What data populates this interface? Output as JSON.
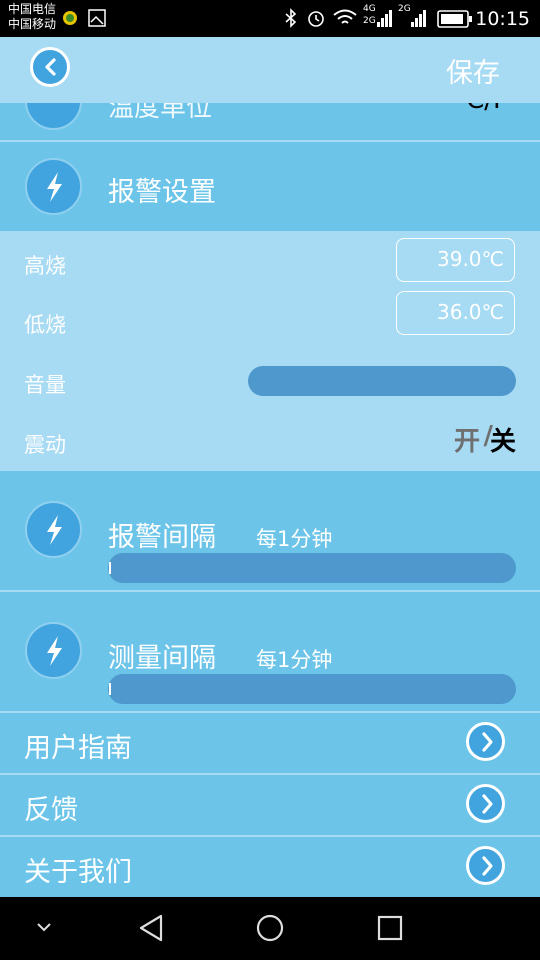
{
  "status_bar": {
    "carrier_1": "中国电信",
    "carrier_2": "中国移动",
    "net_label_1": "4G",
    "net_label_2": "2G",
    "net_label_3": "2G",
    "time": "10:15"
  },
  "header": {
    "save_label": "保存"
  },
  "temperature_row": {
    "label": "温度单位",
    "value": "C/F"
  },
  "alarm_settings": {
    "title": "报警设置",
    "high_fever_label": "高烧",
    "high_fever_value": "39.0℃",
    "low_fever_label": "低烧",
    "low_fever_value": "36.0℃",
    "volume_label": "音量",
    "vibration_label": "震动",
    "toggle_on": "开",
    "toggle_separator": "/",
    "toggle_off": "关"
  },
  "alarm_interval": {
    "title": "报警间隔",
    "value": "每1分钟"
  },
  "measure_interval": {
    "title": "测量间隔",
    "value": "每1分钟"
  },
  "menu": {
    "items": [
      {
        "label": "用户指南"
      },
      {
        "label": "反馈"
      },
      {
        "label": "关于我们"
      }
    ]
  },
  "icons": {
    "back": "chevron-left-icon",
    "section": "lightning-icon",
    "menu_arrow": "chevron-right-icon"
  },
  "colors": {
    "accent_light": "#a7daf3",
    "accent": "#6cc4e9",
    "accent_dark": "#41a4de",
    "bar": "#4e98cd"
  }
}
